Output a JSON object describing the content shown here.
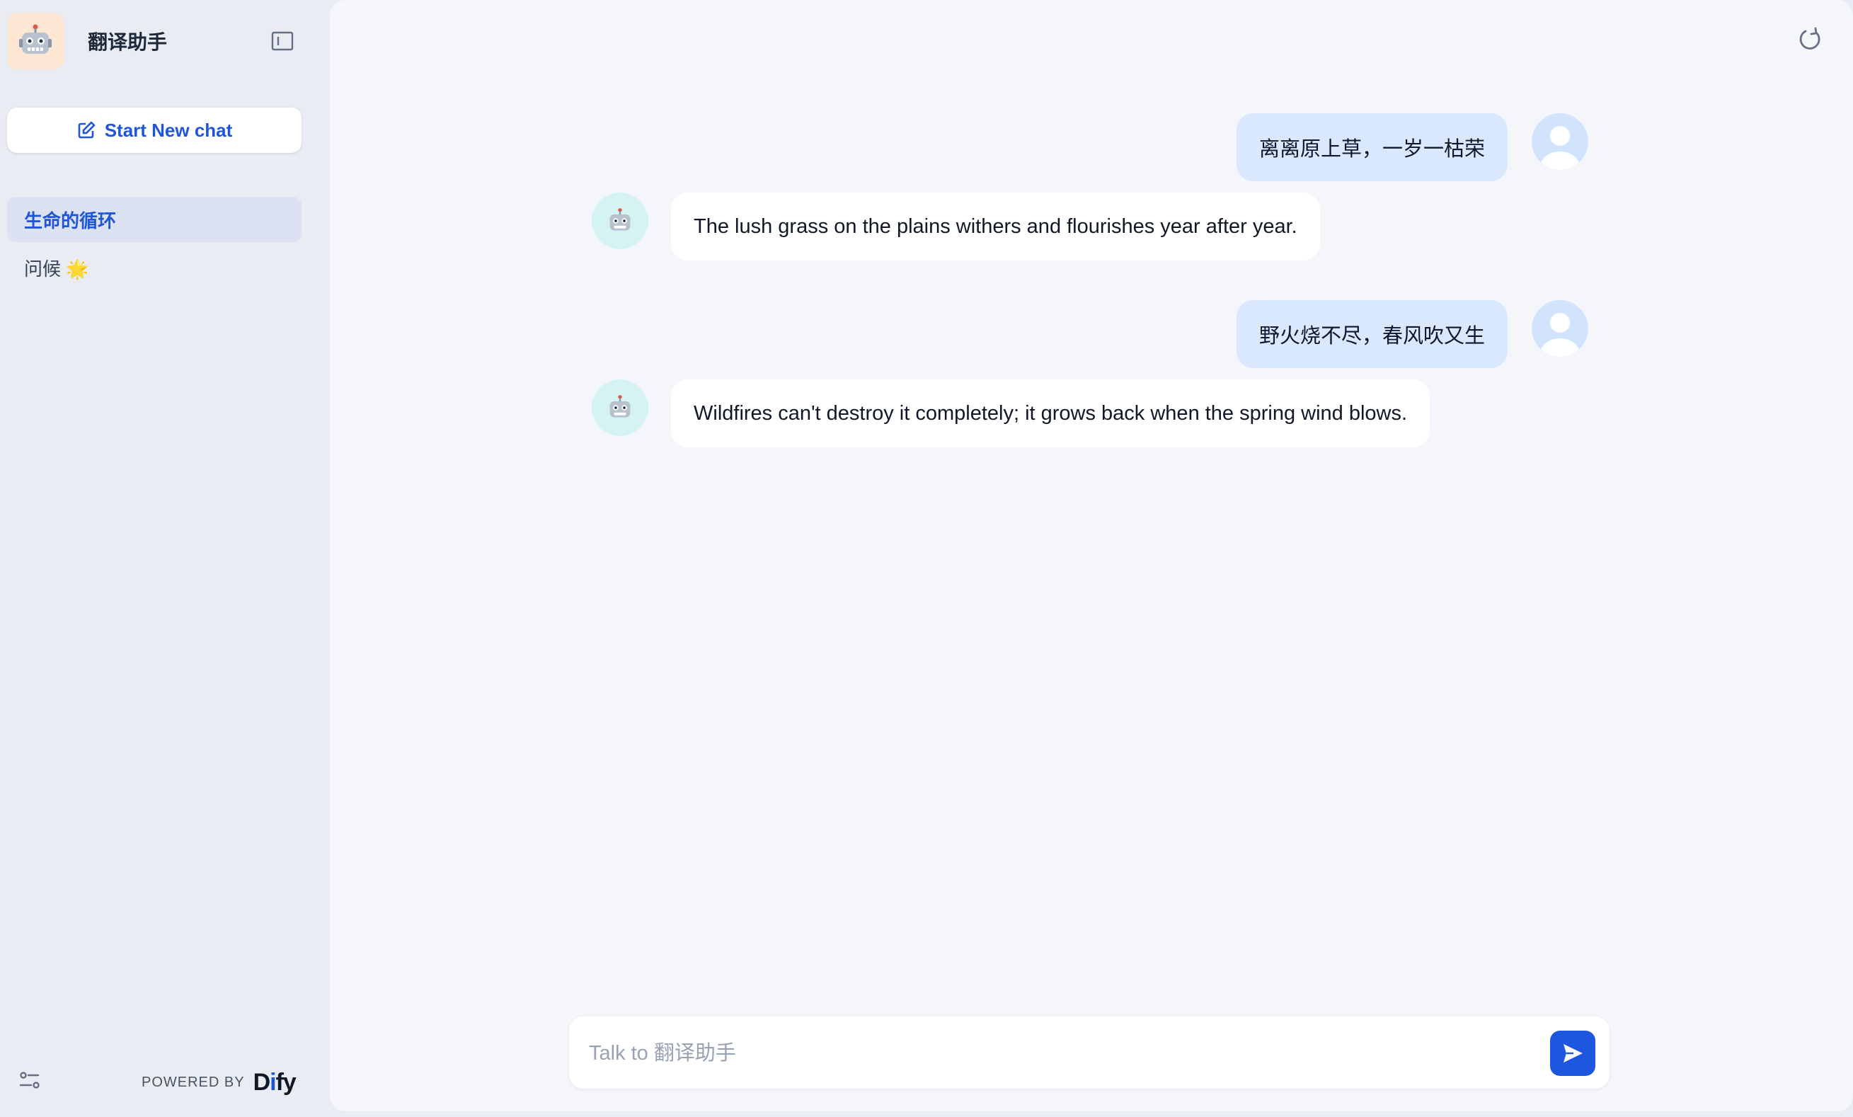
{
  "app": {
    "title": "翻译助手",
    "logo_icon": "robot-face"
  },
  "sidebar": {
    "new_chat_label": "Start New chat",
    "conversations": [
      {
        "label": "生命的循环",
        "active": true
      },
      {
        "label": "问候 🌟",
        "active": false
      }
    ],
    "powered_by_label": "POWERED BY",
    "brand": {
      "prefix": "D",
      "accent": "i",
      "suffix": "fy"
    }
  },
  "chat": {
    "messages": [
      {
        "role": "user",
        "text": "离离原上草，一岁一枯荣"
      },
      {
        "role": "assistant",
        "text": "The lush grass on the plains withers and flourishes year after year."
      },
      {
        "role": "user",
        "text": "野火烧不尽，春风吹又生"
      },
      {
        "role": "assistant",
        "text": "Wildfires can't destroy it completely; it grows back when the spring wind blows."
      }
    ]
  },
  "input": {
    "placeholder": "Talk to 翻译助手",
    "value": ""
  },
  "colors": {
    "accent": "#1f56e0",
    "user_bubble": "#d9e8fe",
    "sidebar_bg": "#e9ecf2",
    "main_bg": "#f4f6fa"
  }
}
